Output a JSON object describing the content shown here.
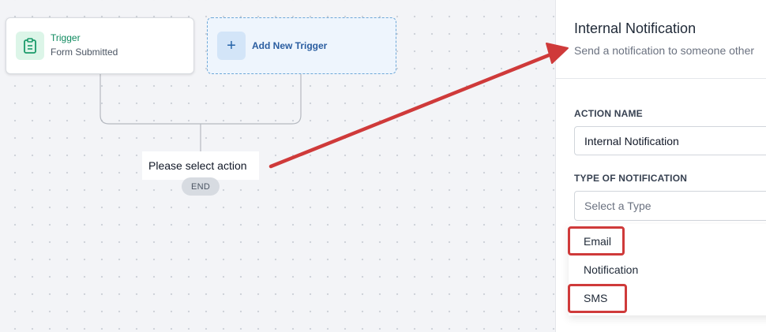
{
  "canvas": {
    "trigger": {
      "title": "Trigger",
      "subtitle": "Form Submitted",
      "icon": "clipboard-icon"
    },
    "add_trigger": {
      "label": "Add New Trigger",
      "icon": "plus-icon"
    },
    "action_placeholder": "Please select action",
    "end_label": "END"
  },
  "panel": {
    "title": "Internal Notification",
    "subtitle": "Send a notification to someone other",
    "action_name": {
      "label": "ACTION NAME",
      "value": "Internal Notification"
    },
    "notification_type": {
      "label": "TYPE OF NOTIFICATION",
      "placeholder": "Select a Type",
      "options": [
        "Email",
        "Notification",
        "SMS"
      ]
    }
  },
  "colors": {
    "trigger_green": "#0f8a5f",
    "add_blue": "#2a5da0",
    "annotation_red": "#cf3a3a"
  }
}
